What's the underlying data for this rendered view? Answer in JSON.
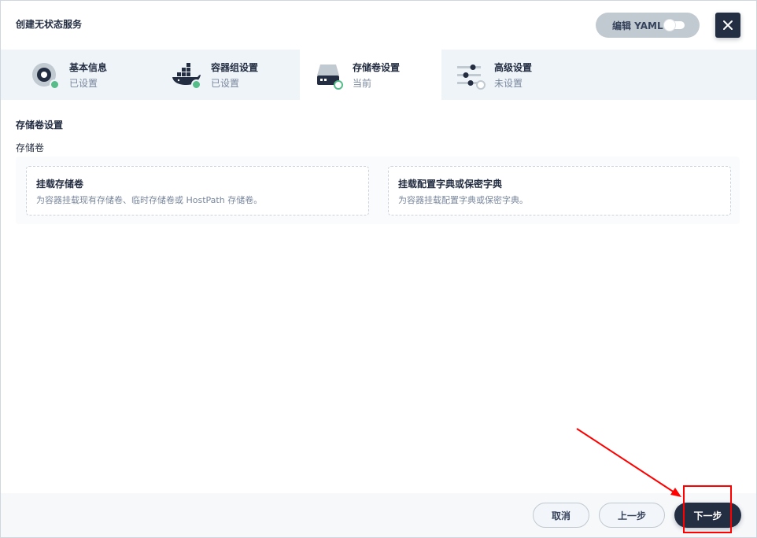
{
  "header": {
    "title": "创建无状态服务",
    "yaml_label": "编辑 YAML"
  },
  "steps": [
    {
      "title": "基本信息",
      "status": "已设置",
      "icon": "settings-disc-icon",
      "state": "done"
    },
    {
      "title": "容器组设置",
      "status": "已设置",
      "icon": "docker-whale-icon",
      "state": "done"
    },
    {
      "title": "存储卷设置",
      "status": "当前",
      "icon": "storage-drive-icon",
      "state": "current"
    },
    {
      "title": "高级设置",
      "status": "未设置",
      "icon": "sliders-icon",
      "state": "pending"
    }
  ],
  "main": {
    "section_title": "存储卷设置",
    "field_label": "存储卷",
    "cards": [
      {
        "title": "挂载存储卷",
        "desc": "为容器挂载现有存储卷、临时存储卷或 HostPath 存储卷。"
      },
      {
        "title": "挂载配置字典或保密字典",
        "desc": "为容器挂载配置字典或保密字典。"
      }
    ]
  },
  "footer": {
    "cancel_label": "取消",
    "prev_label": "上一步",
    "next_label": "下一步"
  },
  "colors": {
    "primary": "#242e42",
    "success": "#55bc8a",
    "annotation": "#ff0000"
  }
}
